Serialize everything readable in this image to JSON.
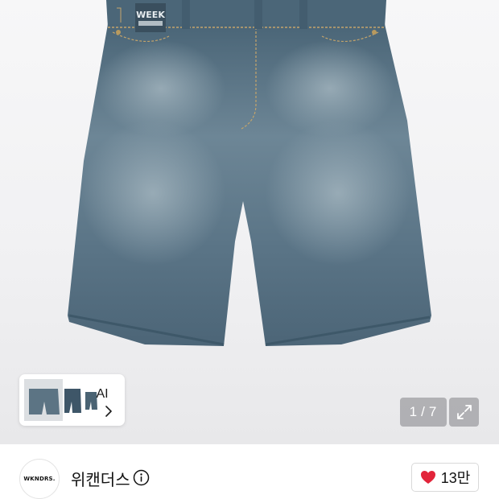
{
  "product": {
    "image": "denim-bermuda-shorts",
    "waist_patch_text": "WEEK"
  },
  "gallery": {
    "current_page": "1",
    "separator": "/",
    "total_pages": "7",
    "expand_icon": "expand-icon"
  },
  "ai_panel": {
    "label": "AI",
    "chevron_icon": "chevron-right-icon"
  },
  "brand": {
    "logo_text": "WKNDRS.",
    "name": "위캔더스",
    "info_icon": "info-icon"
  },
  "like": {
    "icon": "heart-icon",
    "count": "13만",
    "color": "#e2243a"
  },
  "colors": {
    "denim": "#4d6a80",
    "denim_light": "#7f97a6",
    "background": "#f2f2f4"
  }
}
